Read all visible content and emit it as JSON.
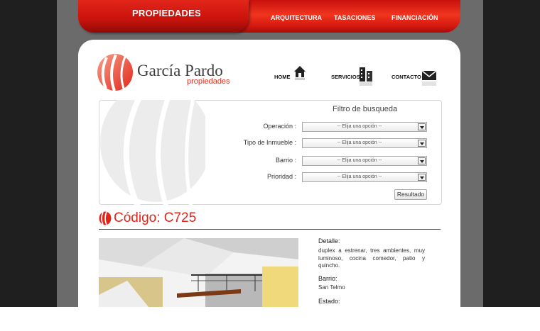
{
  "topnav": {
    "active_tab": "PROPIEDADES",
    "links": [
      "ARQUITECTURA",
      "TASACIONES",
      "FINANCIACIÓN"
    ]
  },
  "logo": {
    "name": "García Pardo",
    "subtitle": "propiedades"
  },
  "mainnav": {
    "home": "HOME",
    "servicios": "SERVICIOS",
    "contacto": "CONTACTO"
  },
  "filter": {
    "title": "Filtro de busqueda",
    "fields": [
      {
        "label": "Operación :",
        "value": "-- Elija una opción --"
      },
      {
        "label": "Tipo de Inmueble :",
        "value": "-- Elija una opción --"
      },
      {
        "label": "Barrio :",
        "value": "-- Elija una opción --"
      },
      {
        "label": "Prioridad :",
        "value": "-- Elija una opción --"
      }
    ],
    "button": "Resultado"
  },
  "property": {
    "code_title": "Código: C725",
    "detalle_label": "Detalle:",
    "detalle": "duplex a estrenar, tres ambientes, muy luminoso, cocina comedor, patio y quincho.",
    "barrio_label": "Barrio:",
    "barrio": "San Telmo",
    "estado_label": "Estado:"
  },
  "colors": {
    "brand_red": "#e2251b",
    "nav_red": "#d51910",
    "dark_bg": "#1f1f1f",
    "mid_bg": "#6b6b6b"
  }
}
